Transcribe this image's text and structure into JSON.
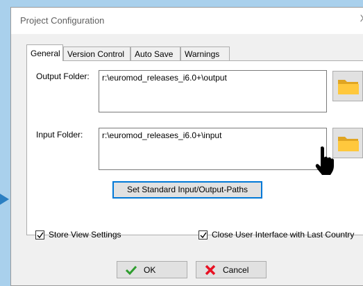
{
  "dialog": {
    "title": "Project Configuration",
    "close_glyph": "X"
  },
  "tabs": [
    {
      "label": "General",
      "active": true
    },
    {
      "label": "Version Control",
      "active": false
    },
    {
      "label": "Auto Save",
      "active": false
    },
    {
      "label": "Warnings",
      "active": false
    }
  ],
  "general": {
    "output_label": "Output Folder:",
    "output_value": "r:\\euromod_releases_i6.0+\\output",
    "input_label": "Input Folder:",
    "input_value": "r:\\euromod_releases_i6.0+\\input",
    "standard_paths_button": "Set Standard Input/Output-Paths"
  },
  "options": {
    "store_view_settings": {
      "label": "Store View Settings",
      "checked": true
    },
    "close_ui_last_country": {
      "label": "Close User Interface with Last Country",
      "checked": true
    }
  },
  "buttons": {
    "ok": "OK",
    "cancel": "Cancel"
  },
  "icons": {
    "folder": "folder-icon",
    "ok": "checkmark-icon",
    "cancel": "red-x-icon",
    "cursor": "hand-pointer-icon",
    "arrow": "arrow-right-icon"
  },
  "colors": {
    "background": "#a9d0ec",
    "folder": "#ffc83d",
    "ok_check": "#2e9d2e",
    "cancel_x": "#e81123",
    "focus_border": "#0078d7",
    "arrow": "#2b7fc2"
  }
}
